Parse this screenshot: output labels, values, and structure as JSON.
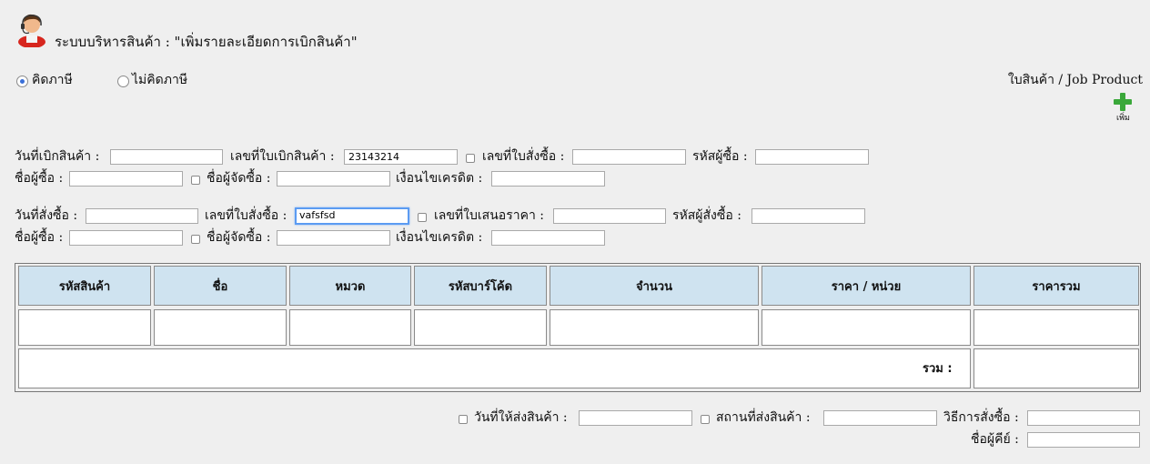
{
  "header": {
    "title": "ระบบบริหารสินค้า : \"เพิ่มรายละเอียดการเบิกสินค้า\"",
    "avatar_icon": "support-agent-icon"
  },
  "tax": {
    "option_tax": "คิดภาษี",
    "option_no_tax": "ไม่คิดภาษี",
    "selected": "คิดภาษี"
  },
  "job_product": {
    "label": "ใบสินค้า / Job Product",
    "add_label": "เพิ่ม",
    "add_icon": "plus-icon",
    "icon_color": "#3aa83a"
  },
  "withdraw": {
    "date_label": "วันที่เบิกสินค้า :",
    "date_value": "",
    "number_label": "เลขที่ใบเบิกสินค้า :",
    "number_value": "23143214",
    "po_label": "เลขที่ใบสั่งซื้อ :",
    "po_value": "",
    "buyer_code_label": "รหัสผู้ซื้อ :",
    "buyer_code_value": "",
    "buyer_name_label": "ชื่อผู้ซื้อ :",
    "buyer_name_value": "",
    "purchaser_label": "ชื่อผู้จัดซื้อ :",
    "purchaser_value": "",
    "credit_label": "เงื่อนไขเครดิต :",
    "credit_value": ""
  },
  "order": {
    "date_label": "วันที่สั่งซื้อ :",
    "date_value": "",
    "po_label": "เลขที่ใบสั่งซื้อ :",
    "po_value": "vafsfsd",
    "quote_label": "เลขที่ใบเสนอราคา :",
    "quote_value": "",
    "orderer_code_label": "รหัสผู้สั่งซื้อ :",
    "orderer_code_value": "",
    "buyer_name_label": "ชื่อผู้ซื้อ :",
    "buyer_name_value": "",
    "purchaser_label": "ชื่อผู้จัดซื้อ :",
    "purchaser_value": "",
    "credit_label": "เงื่อนไขเครดิต :",
    "credit_value": ""
  },
  "table": {
    "headers": [
      "รหัสสินค้า",
      "ชื่อ",
      "หมวด",
      "รหัสบาร์โค้ด",
      "จำนวน",
      "ราคา / หน่วย",
      "ราคารวม"
    ],
    "total_label": "รวม :",
    "header_color": "#cfe3f0"
  },
  "footer": {
    "delivery_date_label": "วันที่ให้ส่งสินค้า :",
    "delivery_date_value": "",
    "delivery_place_label": "สถานที่ส่งสินค้า :",
    "delivery_place_value": "",
    "order_method_label": "วิธีการสั่งซื้อ :",
    "order_method_value": "",
    "keyer_label": "ชื่อผู้คีย์ :",
    "keyer_value": ""
  }
}
